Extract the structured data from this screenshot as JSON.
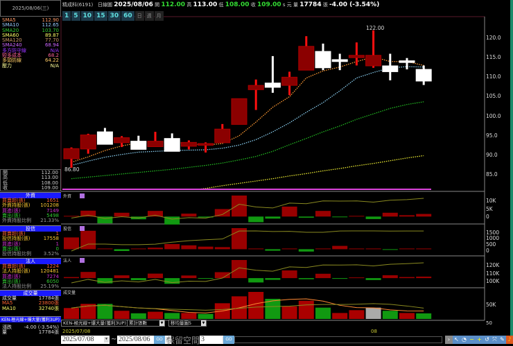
{
  "header": {
    "date_box": "2025/08/06(三)",
    "stock_name": "精成科(6191)",
    "chart_type": "日線圖",
    "date": "2025/08/06",
    "open_label": "開",
    "open": "112.00",
    "high_label": "高",
    "high": "113.00",
    "low_label": "低",
    "low": "108.00",
    "close_label": "收",
    "close": "109.00",
    "unit": "s 元",
    "volume_label": "量",
    "volume": "17784",
    "volume_unit": "張",
    "change": "-4.00 (-3.54%)",
    "periods": [
      "1",
      "5",
      "10",
      "15",
      "30",
      "60",
      "日",
      "週",
      "月"
    ]
  },
  "sma": [
    {
      "label": "SMA5",
      "value": "112.90",
      "color": "#ff9966"
    },
    {
      "label": "SMA10",
      "value": "112.65",
      "color": "#99ccff"
    },
    {
      "label": "SMA20",
      "value": "103.70",
      "color": "#33cc33"
    },
    {
      "label": "SMA60",
      "value": "89.87",
      "color": "#ffff66"
    },
    {
      "label": "SMA120",
      "value": "77.70",
      "color": "#cc9966"
    },
    {
      "label": "SMA240",
      "value": "68.94",
      "color": "#cc66ff"
    },
    {
      "label": "多方防守線",
      "value": "N/A",
      "color": "#9933ff"
    },
    {
      "label": "短多成本",
      "value": "68.2",
      "color": "#ff6699"
    },
    {
      "label": "多頭防線",
      "value": "64.22",
      "color": "#ffcc66"
    },
    {
      "label": "壓力",
      "value": "N/A",
      "color": "#ffff99"
    }
  ],
  "ohlc_box": [
    {
      "label": "開",
      "value": "112.00"
    },
    {
      "label": "高",
      "value": "113.00"
    },
    {
      "label": "低",
      "value": "108.00"
    },
    {
      "label": "收",
      "value": "109.00"
    }
  ],
  "foreign": {
    "title": "外資",
    "rows": [
      {
        "label": "買賣超(張)",
        "value": "1651",
        "color": "#ff6633"
      },
      {
        "label": "外資持股(張)",
        "value": "101208",
        "color": "#ffcc33"
      },
      {
        "label": "買進(張)",
        "value": "7149",
        "color": "#cc33cc"
      },
      {
        "label": "賣出(張)",
        "value": "5498",
        "color": "#33cc33"
      },
      {
        "label": "外資持股比例",
        "value": "21.33%",
        "color": "#999999"
      }
    ]
  },
  "trust": {
    "title": "投信",
    "rows": [
      {
        "label": "買賣超(張)",
        "value": "1",
        "color": "#ff6633"
      },
      {
        "label": "投信持股(張)",
        "value": "17558",
        "color": "#ffcc33"
      },
      {
        "label": "買進(張)",
        "value": "1",
        "color": "#cc33cc"
      },
      {
        "label": "賣出(張)",
        "value": "0",
        "color": "#33cc33"
      },
      {
        "label": "投信持股比例",
        "value": "3.52%",
        "color": "#999999"
      }
    ]
  },
  "inst": {
    "title": "法人",
    "rows": [
      {
        "label": "買賣超(張)",
        "value": "1224",
        "color": "#ff6633"
      },
      {
        "label": "法人持股(張)",
        "value": "120481",
        "color": "#ffcc33"
      },
      {
        "label": "買進(張)",
        "value": "7274",
        "color": "#cc33cc"
      },
      {
        "label": "賣出(張)",
        "value": "6050",
        "color": "#33cc33"
      },
      {
        "label": "法人持股比例",
        "value": "25.19%",
        "color": "#999999"
      }
    ]
  },
  "vol": {
    "title": "成交量",
    "rows": [
      {
        "label": "成交量",
        "value": "17784張",
        "color": "#dddddd"
      },
      {
        "label": "MA5",
        "value": "23800張",
        "color": "#ff6633"
      },
      {
        "label": "MA10",
        "value": "32740張",
        "color": "#ffff66"
      }
    ]
  },
  "strategy": {
    "title": "KEN-極光線+爆大量(獲利3UP)",
    "change_label": "漲跌",
    "change": "-4.00 (-3.54%)",
    "volume_label": "量",
    "volume": "17784張"
  },
  "panel_titles": [
    "外資",
    "投信",
    "法人",
    "成交量"
  ],
  "bottom": {
    "strategy_select": "KEN-極光線+爆大量(獲利3UP)",
    "accum_select": "累計張數",
    "ma_select": "移均量圖5",
    "start_tick": "2025/07/08",
    "month_tick": "08",
    "right_label": "50",
    "date_from": "2025/07/08",
    "tilde": "~",
    "date_to": "2025/08/06",
    "go": "GO",
    "reserve_label": "保留空間",
    "reserve_value": "3"
  },
  "chart_data": {
    "type": "candlestick",
    "title": "精成科(6191) 日線圖",
    "ylim": [
      81,
      125
    ],
    "price_ticks": [
      "120.0",
      "115.0",
      "110.0",
      "105.0",
      "100.0",
      "95.0",
      "90.0",
      "85.0"
    ],
    "low_label": "86.80",
    "high_label": "122.00",
    "ohlc": [
      [
        89.1,
        92.0,
        86.8,
        91.7
      ],
      [
        91.6,
        95.5,
        90.4,
        95.2
      ],
      [
        96.0,
        97.0,
        92.8,
        92.8
      ],
      [
        93.2,
        94.9,
        92.1,
        94.5
      ],
      [
        93.6,
        95.0,
        91.5,
        91.5
      ],
      [
        92.2,
        96.0,
        92.2,
        93.6
      ],
      [
        94.3,
        95.6,
        91.0,
        91.0
      ],
      [
        92.3,
        93.8,
        91.5,
        93.3
      ],
      [
        92.6,
        93.3,
        90.7,
        93.0
      ],
      [
        93.2,
        98.0,
        93.2,
        96.7
      ],
      [
        97.9,
        104.5,
        97.9,
        104.5
      ],
      [
        106.8,
        109.4,
        101.6,
        107.9
      ],
      [
        108.5,
        115.4,
        106.0,
        107.4
      ],
      [
        107.9,
        111.4,
        105.4,
        110.0
      ],
      [
        111.8,
        120.5,
        111.8,
        117.9
      ],
      [
        116.6,
        118.6,
        111.8,
        112.4
      ],
      [
        114.5,
        116.0,
        111.8,
        114.0
      ],
      [
        115.0,
        118.9,
        113.0,
        115.6
      ],
      [
        112.9,
        122.0,
        112.4,
        115.6
      ],
      [
        112.9,
        116.0,
        109.2,
        111.4
      ],
      [
        114.2,
        114.9,
        112.0,
        113.9
      ],
      [
        112.0,
        113.0,
        108.0,
        109.0
      ]
    ],
    "ma": [
      {
        "name": "SMA5",
        "color": "#ff9933",
        "values": [
          88.2,
          89.6,
          91.2,
          92.4,
          93.2,
          93.4,
          93.4,
          93.0,
          92.6,
          93.0,
          95.0,
          98.5,
          102.3,
          105.0,
          109.8,
          111.6,
          112.6,
          114.0,
          115.2,
          114.0,
          114.0,
          113.0
        ]
      },
      {
        "name": "SMA10",
        "color": "#88ccee",
        "values": [
          87.4,
          88.5,
          89.5,
          90.2,
          90.8,
          91.0,
          91.2,
          91.3,
          91.4,
          91.8,
          92.6,
          94.0,
          96.0,
          98.3,
          101.0,
          103.5,
          106.5,
          109.8,
          111.2,
          112.4,
          112.7,
          112.6
        ]
      },
      {
        "name": "SMA20",
        "color": "#22bb22",
        "values": [
          84.0,
          84.4,
          84.8,
          85.2,
          85.6,
          86.0,
          86.4,
          86.9,
          87.4,
          88.0,
          88.8,
          89.7,
          91.0,
          92.7,
          94.3,
          96.0,
          97.5,
          99.2,
          100.6,
          102.0,
          103.0,
          103.7
        ]
      },
      {
        "name": "SMA60",
        "color": "#eeee33",
        "values": [
          null,
          null,
          null,
          null,
          null,
          null,
          80.5,
          81.0,
          81.5,
          82.2,
          82.8,
          83.4,
          84.0,
          84.7,
          85.3,
          86.0,
          86.6,
          87.3,
          87.9,
          88.6,
          89.3,
          89.9
        ]
      }
    ],
    "foreign_net": {
      "ticks": [
        "10K",
        "5K",
        "0"
      ],
      "values": [
        0,
        3700,
        -4260,
        2400,
        -1700,
        3550,
        -5000,
        1850,
        -570,
        4700,
        13200,
        -3550,
        -1280,
        6250,
        -710,
        3550,
        -280,
        280,
        -1560,
        2400,
        850,
        1651
      ]
    },
    "trust_net": {
      "ticks": [
        "1500",
        "1000",
        "500",
        "0"
      ],
      "values": [
        850,
        1330,
        0,
        -130,
        0,
        110,
        370,
        280,
        185,
        150,
        1520,
        20,
        -110,
        20,
        -170,
        0,
        240,
        20,
        0,
        -40,
        20,
        1
      ]
    },
    "inst_net": {
      "ticks": [
        "120K",
        "110K",
        "100K"
      ],
      "values": [
        850,
        5030,
        -4260,
        2270,
        -1700,
        3660,
        -4630,
        2130,
        -385,
        4850,
        14720,
        -3530,
        -1390,
        6270,
        -880,
        3550,
        -40,
        300,
        -1560,
        2360,
        870,
        1224
      ]
    },
    "volume": {
      "ticks": [
        "50K"
      ],
      "values": [
        34700,
        48000,
        48000,
        26000,
        18000,
        23000,
        19000,
        19000,
        16000,
        50000,
        72000,
        86000,
        64000,
        40000,
        58000,
        36000,
        19000,
        28000,
        36000,
        26000,
        19000,
        17784
      ],
      "colors": [
        "#aa0000",
        "#aa0000",
        "#119911",
        "#aa0000",
        "#119911",
        "#aa0000",
        "#119911",
        "#aa0000",
        "#119911",
        "#aa0000",
        "#aa0000",
        "#aa0000",
        "#119911",
        "#aa0000",
        "#aa0000",
        "#119911",
        "#aa0000",
        "#aa0000",
        "#aaaaaa",
        "#119911",
        "#aa0000",
        "#119911"
      ]
    }
  }
}
